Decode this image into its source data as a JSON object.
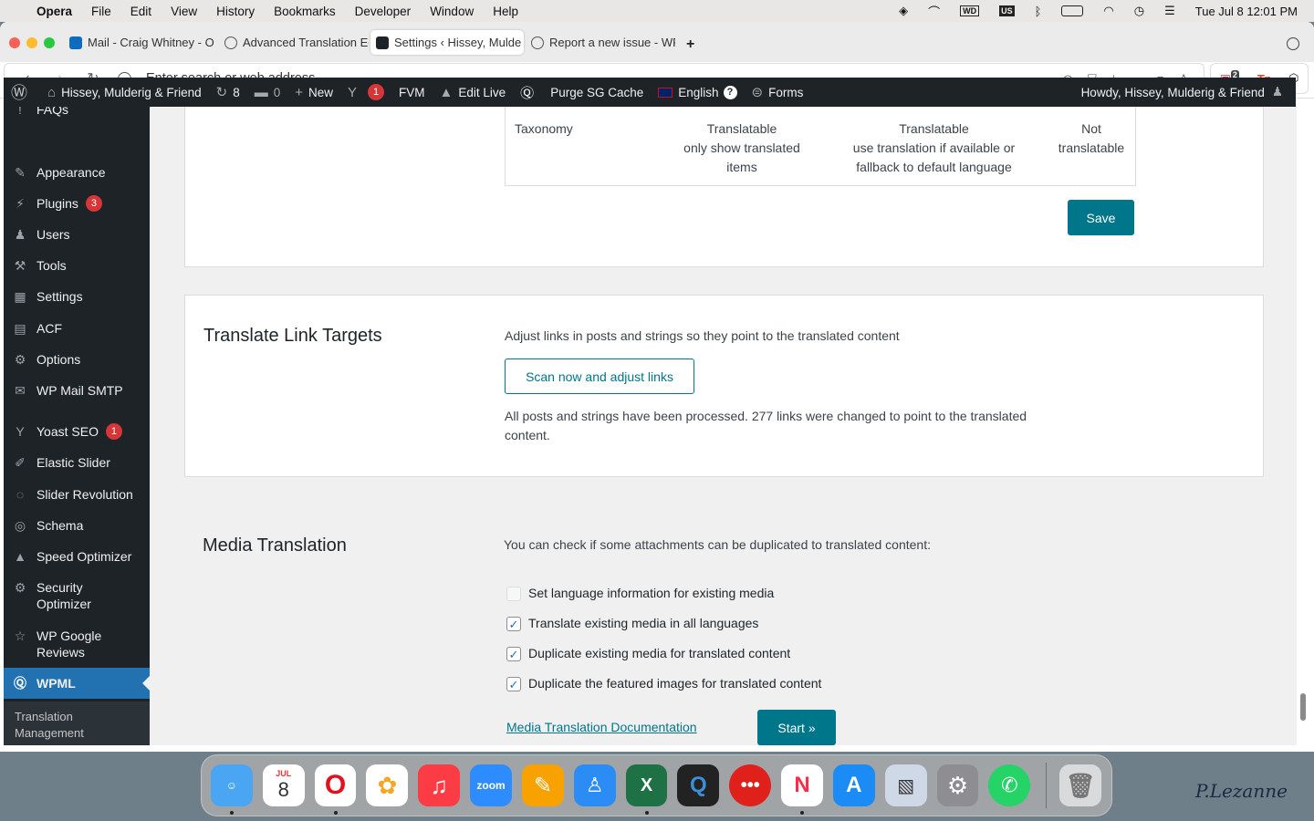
{
  "menubar": {
    "app": "Opera",
    "items": [
      "File",
      "Edit",
      "View",
      "History",
      "Bookmarks",
      "Developer",
      "Window",
      "Help"
    ],
    "clock": "Tue Jul 8  12:01 PM",
    "wd": "WD",
    "us": "US"
  },
  "tabs": [
    {
      "label": "Mail - Craig Whitney - O",
      "color": "#0f6cbd"
    },
    {
      "label": "Advanced Translation Ed",
      "color": "#555"
    },
    {
      "label": "Settings ‹ Hissey, Mulde",
      "color": "#1d2327"
    },
    {
      "label": "Report a new issue - WP",
      "color": "#555"
    }
  ],
  "address": {
    "placeholder": "Enter search or web address",
    "ext_badge": "2"
  },
  "adminbar": {
    "site": "Hissey, Mulderig & Friend",
    "updates": "8",
    "comments": "0",
    "new": "New",
    "yoast_count": "1",
    "fvm": "FVM",
    "edit_live": "Edit Live",
    "purge": "Purge SG Cache",
    "language": "English",
    "forms": "Forms",
    "howdy": "Howdy, Hissey, Mulderig & Friend"
  },
  "sidebar": {
    "faqs": "FAQs",
    "appearance": "Appearance",
    "plugins": "Plugins",
    "plugins_count": "3",
    "users": "Users",
    "tools": "Tools",
    "settings": "Settings",
    "acf": "ACF",
    "options": "Options",
    "wpmail": "WP Mail SMTP",
    "yoast": "Yoast SEO",
    "yoast_count": "1",
    "elastic": "Elastic Slider",
    "slider_rev": "Slider Revolution",
    "schema": "Schema",
    "speed": "Speed Optimizer",
    "security": "Security Optimizer",
    "reviews": "WP Google Reviews",
    "wpml": "WPML",
    "sub": "Translation Management"
  },
  "taxonomy_table": {
    "row_label": "Taxonomy",
    "col1": "Translatable",
    "col1_sub": "only show translated items",
    "col2": "Translatable",
    "col2_sub": "use translation if available or fallback to default language",
    "col3": "Not translatable",
    "save": "Save"
  },
  "link_targets": {
    "title": "Translate Link Targets",
    "description": "Adjust links in posts and strings so they point to the translated content",
    "button": "Scan now and adjust links",
    "result": "All posts and strings have been processed. 277 links were changed to point to the translated content."
  },
  "media": {
    "title": "Media Translation",
    "description": "You can check if some attachments can be duplicated to translated content:",
    "options": [
      {
        "label": "Set language information for existing media",
        "checked": false
      },
      {
        "label": "Translate existing media in all languages",
        "checked": true
      },
      {
        "label": "Duplicate existing media for translated content",
        "checked": true
      },
      {
        "label": "Duplicate the featured images for translated content",
        "checked": true
      }
    ],
    "doc_link": "Media Translation Documentation",
    "start": "Start »"
  },
  "dock": {
    "calendar_month": "JUL",
    "calendar_day": "8",
    "zoom": "zoom"
  },
  "signature": "P.Lezanne"
}
